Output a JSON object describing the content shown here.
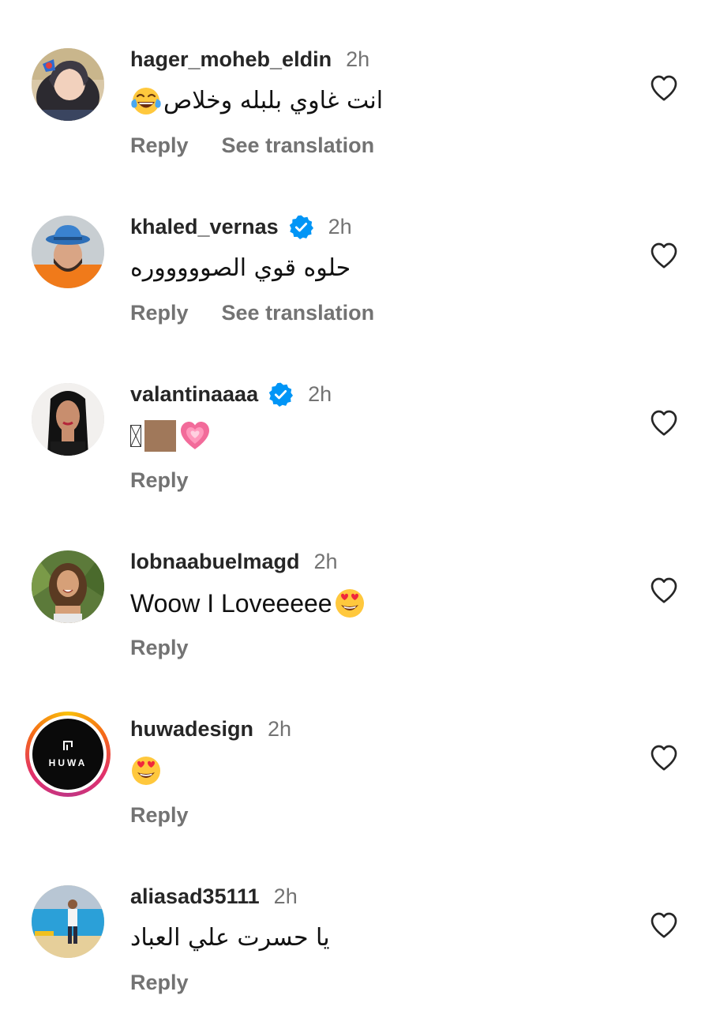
{
  "colors": {
    "username": "#262626",
    "meta": "#737373",
    "verified": "#0095f6",
    "heart_outline": "#262626",
    "story_ring": "#e1306c"
  },
  "comments": [
    {
      "username": "hager_moheb_eldin",
      "verified": false,
      "time": "2h",
      "text": "انت غاوي بلبله وخلاص",
      "text_dir": "rtl",
      "emoji": "face-with-tears-of-joy",
      "actions": {
        "reply": "Reply",
        "translate": "See translation"
      },
      "avatar": "hijab-woman-photo"
    },
    {
      "username": "khaled_vernas",
      "verified": true,
      "time": "2h",
      "text": "حلوه قوي الصوووووره",
      "text_dir": "rtl",
      "actions": {
        "reply": "Reply",
        "translate": "See translation"
      },
      "avatar": "man-blue-hat-photo"
    },
    {
      "username": "valantinaaaa",
      "verified": true,
      "time": "2h",
      "text": "",
      "emoji": [
        "missing-glyph",
        "skin-tone-block",
        "growing-heart"
      ],
      "actions": {
        "reply": "Reply"
      },
      "avatar": "dark-hair-woman-photo"
    },
    {
      "username": "lobnaabuelmagd",
      "verified": false,
      "time": "2h",
      "text": "Woow I Loveeeee",
      "text_dir": "ltr",
      "emoji": "heart-eyes",
      "actions": {
        "reply": "Reply"
      },
      "avatar": "curly-hair-woman-photo"
    },
    {
      "username": "huwadesign",
      "verified": false,
      "time": "2h",
      "text": "",
      "emoji": "heart-eyes",
      "actions": {
        "reply": "Reply"
      },
      "avatar": "huwa-logo",
      "avatar_text": "HUWA",
      "has_story": true
    },
    {
      "username": "aliasad35111",
      "verified": false,
      "time": "2h",
      "text": "يا حسرت علي العباد",
      "text_dir": "rtl",
      "actions": {
        "reply": "Reply"
      },
      "avatar": "man-by-pool-photo"
    }
  ]
}
